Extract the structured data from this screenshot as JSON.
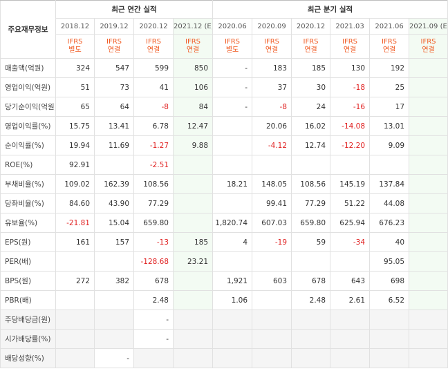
{
  "header": {
    "corner_label": "주요재무정보",
    "annual_title": "최근 연간 실적",
    "quarterly_title": "최근 분기 실적"
  },
  "columns": [
    {
      "date": "2018.12",
      "ifrs_top": "IFRS",
      "ifrs_bottom": "별도",
      "estimate": false,
      "quarter": false
    },
    {
      "date": "2019.12",
      "ifrs_top": "IFRS",
      "ifrs_bottom": "연결",
      "estimate": false,
      "quarter": false
    },
    {
      "date": "2020.12",
      "ifrs_top": "IFRS",
      "ifrs_bottom": "연결",
      "estimate": false,
      "quarter": false
    },
    {
      "date": "2021.12 (E)",
      "ifrs_top": "IFRS",
      "ifrs_bottom": "연결",
      "estimate": true,
      "quarter": false
    },
    {
      "date": "2020.06",
      "ifrs_top": "IFRS",
      "ifrs_bottom": "별도",
      "estimate": false,
      "quarter": true
    },
    {
      "date": "2020.09",
      "ifrs_top": "IFRS",
      "ifrs_bottom": "연결",
      "estimate": false,
      "quarter": true
    },
    {
      "date": "2020.12",
      "ifrs_top": "IFRS",
      "ifrs_bottom": "연결",
      "estimate": false,
      "quarter": true
    },
    {
      "date": "2021.03",
      "ifrs_top": "IFRS",
      "ifrs_bottom": "연결",
      "estimate": false,
      "quarter": true
    },
    {
      "date": "2021.06",
      "ifrs_top": "IFRS",
      "ifrs_bottom": "연결",
      "estimate": false,
      "quarter": true
    },
    {
      "date": "2021.09 (E)",
      "ifrs_top": "IFRS",
      "ifrs_bottom": "연결",
      "estimate": true,
      "quarter": true
    }
  ],
  "rows": [
    {
      "label": "매출액(억원)",
      "values": [
        "324",
        "547",
        "599",
        "850",
        "-",
        "183",
        "185",
        "130",
        "192",
        ""
      ],
      "section_start": false
    },
    {
      "label": "영업이익(억원)",
      "values": [
        "51",
        "73",
        "41",
        "106",
        "-",
        "37",
        "30",
        "-18",
        "25",
        ""
      ],
      "section_start": false
    },
    {
      "label": "당기순이익(억원)",
      "values": [
        "65",
        "64",
        "-8",
        "84",
        "-",
        "-8",
        "24",
        "-16",
        "17",
        ""
      ],
      "section_start": false
    },
    {
      "label": "영업이익률(%)",
      "values": [
        "15.75",
        "13.41",
        "6.78",
        "12.47",
        "",
        "20.06",
        "16.02",
        "-14.08",
        "13.01",
        ""
      ],
      "section_start": true
    },
    {
      "label": "순이익률(%)",
      "values": [
        "19.94",
        "11.69",
        "-1.27",
        "9.88",
        "",
        "-4.12",
        "12.74",
        "-12.20",
        "9.09",
        ""
      ],
      "section_start": false
    },
    {
      "label": "ROE(%)",
      "values": [
        "92.91",
        "",
        "-2.51",
        "",
        "",
        "",
        "",
        "",
        "",
        ""
      ],
      "section_start": false
    },
    {
      "label": "부채비율(%)",
      "values": [
        "109.02",
        "162.39",
        "108.56",
        "",
        "18.21",
        "148.05",
        "108.56",
        "145.19",
        "137.84",
        ""
      ],
      "section_start": true
    },
    {
      "label": "당좌비율(%)",
      "values": [
        "84.60",
        "43.90",
        "77.29",
        "",
        "",
        "99.41",
        "77.29",
        "51.22",
        "44.08",
        ""
      ],
      "section_start": false
    },
    {
      "label": "유보율(%)",
      "values": [
        "-21.81",
        "15.04",
        "659.80",
        "",
        "1,820.74",
        "607.03",
        "659.80",
        "625.94",
        "676.23",
        ""
      ],
      "section_start": false
    },
    {
      "label": "EPS(원)",
      "values": [
        "161",
        "157",
        "-13",
        "185",
        "4",
        "-19",
        "59",
        "-34",
        "40",
        ""
      ],
      "section_start": true
    },
    {
      "label": "PER(배)",
      "values": [
        "",
        "",
        "-128.68",
        "23.21",
        "",
        "",
        "",
        "",
        "95.05",
        ""
      ],
      "section_start": false
    },
    {
      "label": "BPS(원)",
      "values": [
        "272",
        "382",
        "678",
        "",
        "1,921",
        "603",
        "678",
        "643",
        "698",
        ""
      ],
      "section_start": false
    },
    {
      "label": "PBR(배)",
      "values": [
        "",
        "",
        "2.48",
        "",
        "1.06",
        "",
        "2.48",
        "2.61",
        "6.52",
        ""
      ],
      "section_start": false
    },
    {
      "label": "주당배당금(원)",
      "values": [
        "",
        "",
        "-",
        "",
        "",
        "",
        "",
        "",
        "",
        ""
      ],
      "section_start": true,
      "gray": true
    },
    {
      "label": "시가배당률(%)",
      "values": [
        "",
        "",
        "-",
        "",
        "",
        "",
        "",
        "",
        "",
        ""
      ],
      "section_start": false,
      "gray": true
    },
    {
      "label": "배당성향(%)",
      "values": [
        "",
        "-",
        "",
        "",
        "",
        "",
        "",
        "",
        "",
        ""
      ],
      "section_start": false,
      "gray": true
    }
  ]
}
